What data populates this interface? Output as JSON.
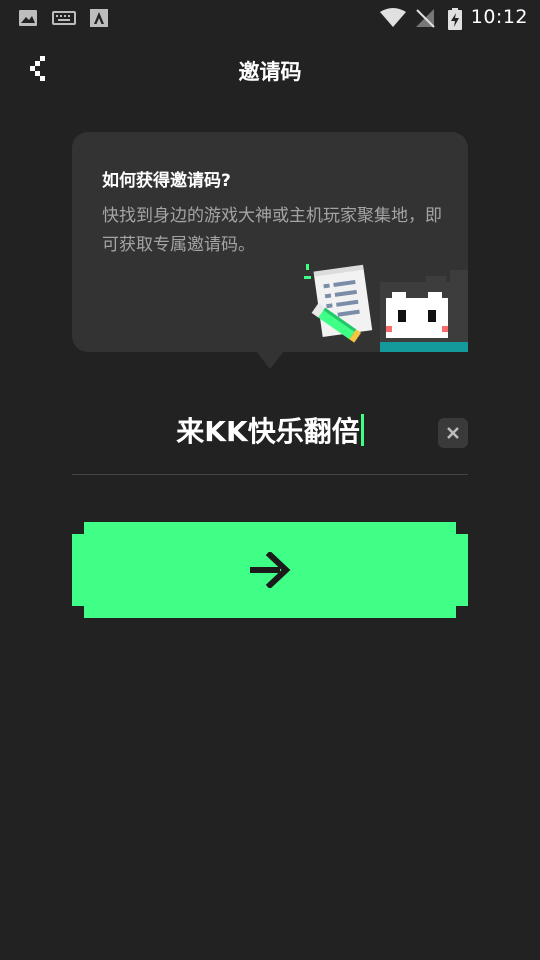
{
  "status_bar": {
    "time": "10:12",
    "icons": [
      "image-icon",
      "keyboard-icon",
      "android-icon",
      "wifi-icon",
      "no-signal-icon",
      "battery-charging-icon"
    ]
  },
  "toolbar": {
    "back_icon": "back-icon",
    "title": "邀请码"
  },
  "info_card": {
    "title": "如何获得邀请码?",
    "description": "快找到身边的游戏大神或主机玩家聚集地，即可获取专属邀请码。",
    "illustration": "mascot-with-notepad-illustration"
  },
  "code_input": {
    "value": "来KK快乐翻倍",
    "clear_icon": "close-icon"
  },
  "submit": {
    "icon": "arrow-right-icon"
  },
  "colors": {
    "background": "#222222",
    "card": "#333333",
    "accent": "#3fff87",
    "muted_text": "#a4a4a4",
    "teal": "#139a9a"
  }
}
